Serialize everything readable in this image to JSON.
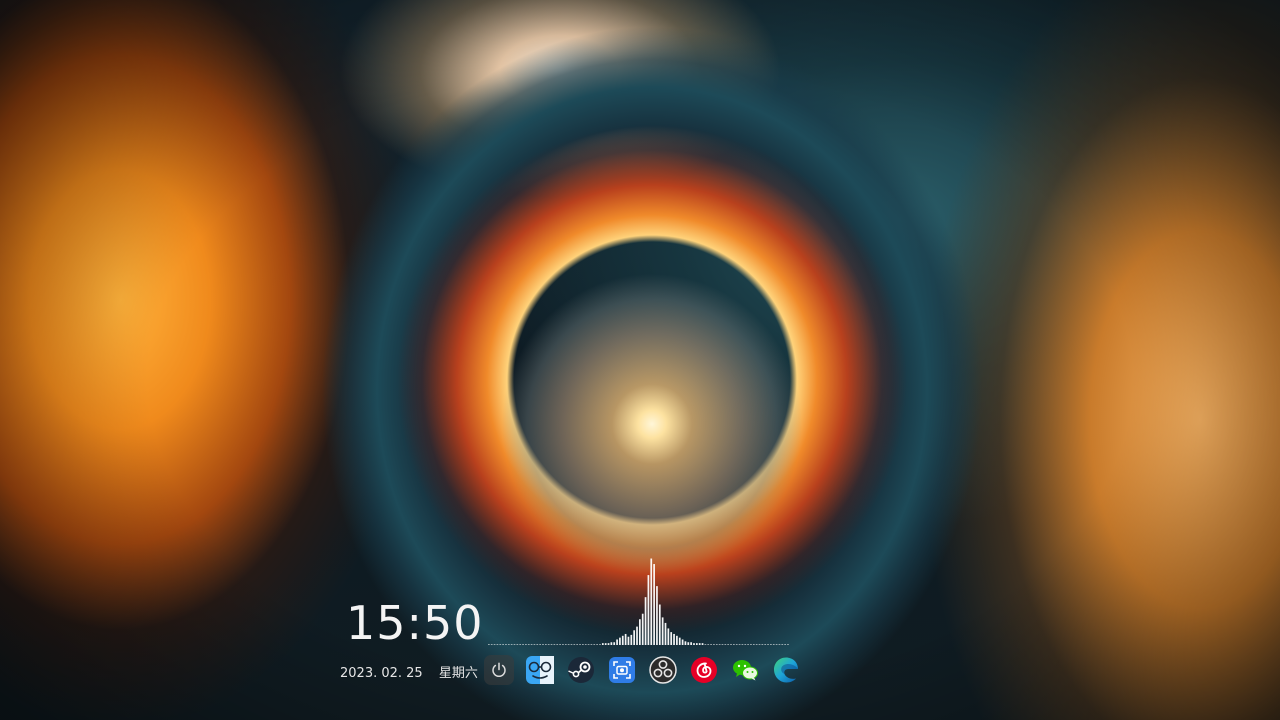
{
  "clock": {
    "time": "15:50",
    "date": "2023. 02. 25",
    "weekday": "星期六"
  },
  "visualizer": {
    "bars": [
      1,
      1,
      1,
      1,
      1,
      1,
      1,
      1,
      1,
      1,
      1,
      1,
      1,
      1,
      1,
      1,
      1,
      1,
      1,
      1,
      1,
      1,
      1,
      1,
      1,
      1,
      1,
      1,
      1,
      1,
      1,
      1,
      1,
      1,
      1,
      1,
      1,
      1,
      1,
      1,
      2,
      2,
      2,
      3,
      3,
      6,
      8,
      10,
      12,
      9,
      11,
      16,
      20,
      28,
      34,
      52,
      76,
      94,
      88,
      64,
      44,
      30,
      24,
      18,
      14,
      12,
      10,
      8,
      6,
      4,
      3,
      3,
      2,
      2,
      2,
      2,
      1,
      1,
      1,
      1,
      1,
      1,
      1,
      1,
      1,
      1,
      1,
      1,
      1,
      1,
      1,
      1,
      1,
      1,
      1,
      1,
      1,
      1,
      1,
      1,
      1,
      1,
      1,
      1,
      1,
      1
    ],
    "color": "#ffffff"
  },
  "dock": {
    "items": [
      {
        "name": "power-icon"
      },
      {
        "name": "finder-icon"
      },
      {
        "name": "steam-icon"
      },
      {
        "name": "screenshot-icon"
      },
      {
        "name": "obs-icon"
      },
      {
        "name": "netease-music-icon"
      },
      {
        "name": "wechat-icon"
      },
      {
        "name": "edge-icon"
      }
    ],
    "colors": {
      "finder": "#3aa6f3",
      "steam": "#1b2838",
      "screenshot": "#2f7ce6",
      "obs": "#2b2b2b",
      "netease": "#e60026",
      "wechat": "#2dc100",
      "edge": "#1ea4d8"
    }
  }
}
